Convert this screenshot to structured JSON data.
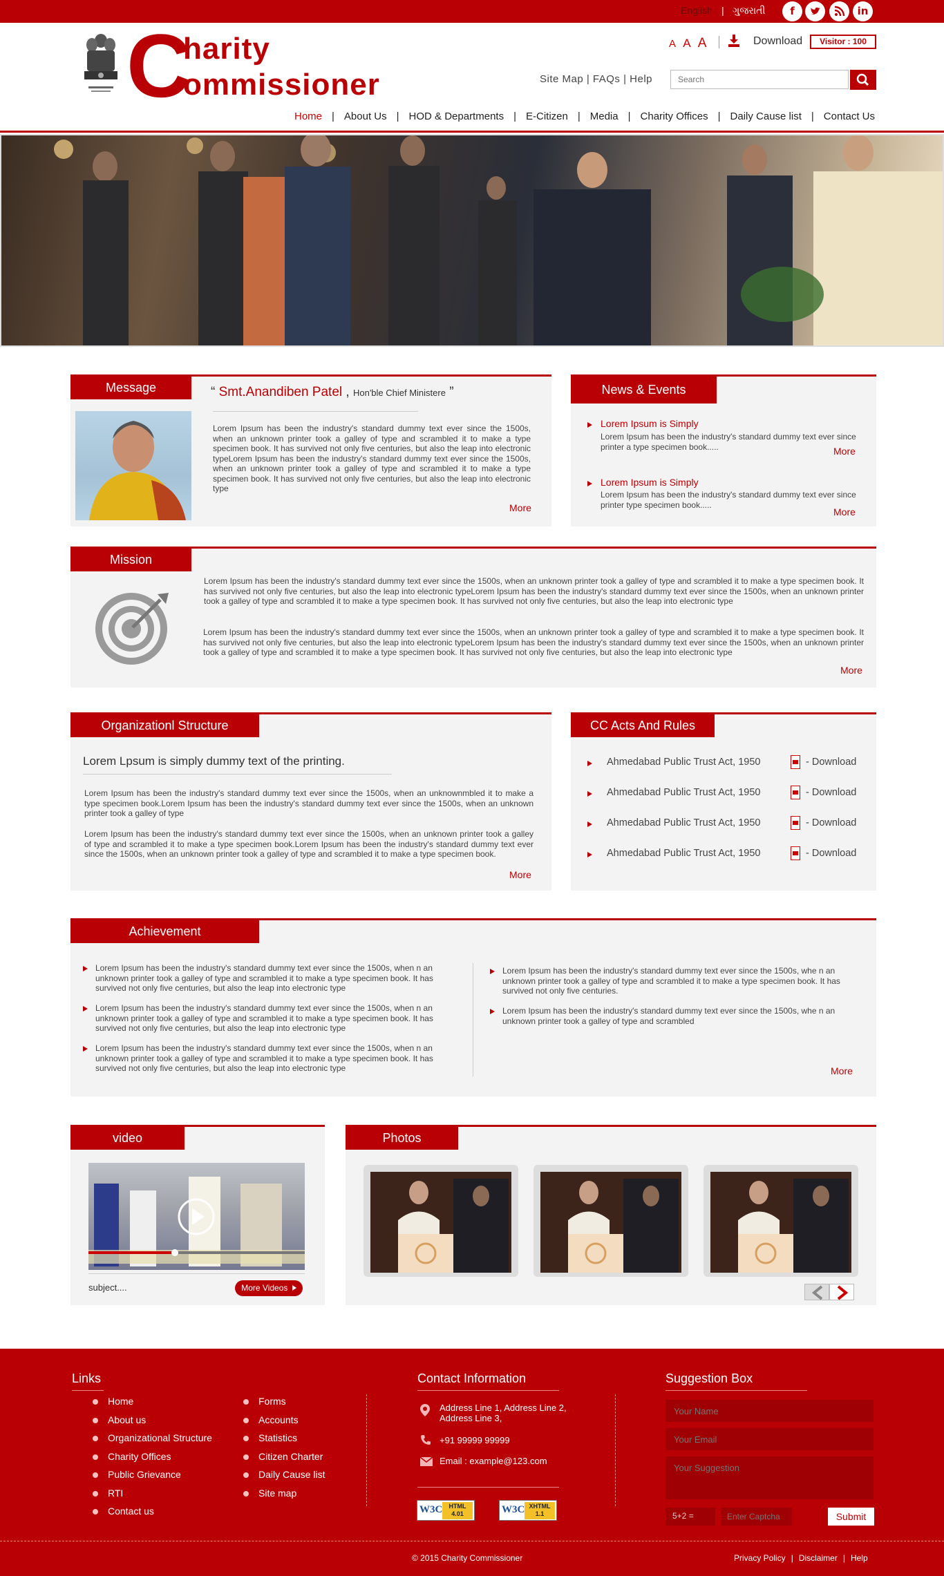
{
  "topbar": {
    "lang_en": "English",
    "lang_sep": "|",
    "lang_gu": "ગુજરાતી",
    "social": [
      "facebook-icon",
      "twitter-icon",
      "rss-icon",
      "linkedin-icon"
    ]
  },
  "header": {
    "logo_big_letter": "C",
    "logo_line1": "harity",
    "logo_line2": "ommissioner",
    "font_sizes": [
      "A",
      "A",
      "A"
    ],
    "download_label": "Download",
    "visitor_label": "Visitor :  100",
    "top_links": "Site Map | FAQs | Help",
    "search_placeholder": "Search"
  },
  "nav": {
    "items": [
      "Home",
      "About Us",
      "HOD & Departments",
      "E-Citizen",
      "Media",
      "Charity Offices",
      "Daily Cause list",
      "Contact Us"
    ],
    "active": "Home",
    "separator": "|"
  },
  "message": {
    "tab": "Message",
    "quote_open": "“",
    "name": "Smt.Anandiben Patel",
    "comma": ",",
    "role": "Hon'ble Chief Ministere",
    "quote_close": "”",
    "body": "Lorem Ipsum has been the industry's standard dummy text ever since the 1500s, when an unknown printer took a galley of type and scrambled it to make a type specimen book. It has survived not only five centuries, but also the leap into electronic typeLorem Ipsum has been the industry's standard dummy text ever since the 1500s, when an unknown printer took a galley of type and scrambled it to make a type specimen book. It has survived not only five centuries, but also the leap into electronic type",
    "more": "More"
  },
  "news": {
    "tab": "News & Events",
    "items": [
      {
        "title": "Lorem Ipsum is Simply",
        "text": "Lorem Ipsum has been the industry's standard dummy text ever since printer a type specimen book.....",
        "more": "More"
      },
      {
        "title": "Lorem Ipsum is Simply",
        "text": "Lorem Ipsum has been the industry's standard dummy text ever since printer type specimen book.....",
        "more": "More"
      }
    ]
  },
  "mission": {
    "tab": "Mission",
    "para1": "Lorem Ipsum has been the industry's standard dummy text ever since the 1500s, when an unknown printer took a galley of type and scrambled it to make a type specimen book. It has survived not only five centuries, but also the leap into electronic typeLorem Ipsum has been the industry's standard dummy text ever since the 1500s, when an unknown printer took a galley of type and scrambled it to make a type specimen book. It has survived not only five centuries, but also the leap into electronic type",
    "para2": "Lorem Ipsum has been the industry's standard dummy text ever since the 1500s, when an unknown printer took a galley of type and scrambled it to make a type specimen book. It has survived not only five centuries, but also the leap into electronic typeLorem Ipsum has been the industry's standard dummy text ever since the 1500s, when an unknown printer took a galley of type and scrambled it to make a type specimen book. It has survived not only five centuries, but also the leap into electronic type",
    "more": "More"
  },
  "org": {
    "tab": "Organizationl Structure",
    "subtitle": "Lorem Lpsum is simply dummy text of the printing.",
    "para1": "Lorem Ipsum has been the industry's standard dummy text ever since the 1500s, when an unknownmbled it to make a type specimen book.Lorem Ipsum has been the industry's standard dummy text ever since the 1500s, when an unknown printer took a galley of type",
    "para2": "Lorem Ipsum has been the industry's standard dummy text ever since the 1500s, when an unknown printer took a galley of type and scrambled it to make a type specimen book.Lorem Ipsum has been the industry's standard dummy text ever since the 1500s, when an unknown printer took a galley of type and scrambled it to make a type specimen book.",
    "more": "More"
  },
  "acts": {
    "tab": "CC Acts And Rules",
    "items": [
      {
        "name": "Ahmedabad Public Trust Act, 1950",
        "link": "- Download"
      },
      {
        "name": "Ahmedabad Public Trust Act, 1950",
        "link": "- Download"
      },
      {
        "name": "Ahmedabad Public Trust Act, 1950",
        "link": "- Download"
      },
      {
        "name": "Ahmedabad Public Trust Act, 1950",
        "link": "- Download"
      }
    ]
  },
  "achievement": {
    "tab": "Achievement",
    "left": [
      "Lorem Ipsum has been the industry's standard dummy text ever since the 1500s, when n an unknown printer took a galley of type and scrambled it to make a type specimen book. It has survived not only five centuries, but also the leap into electronic type",
      "Lorem Ipsum has been the industry's standard dummy text ever since the 1500s, when n an unknown printer took a galley of type and scrambled it to make a type specimen book. It has survived not only five centuries, but also the leap into electronic type",
      "Lorem Ipsum has been the industry's standard dummy text ever since the 1500s, when n an unknown printer took a galley of type and scrambled it to make a type specimen book. It has survived not only five centuries, but also the leap into electronic type"
    ],
    "right": [
      "Lorem Ipsum has been the industry's standard dummy text ever since the 1500s, whe n an unknown printer took a galley of type and scrambled it to make a type specimen book. It has survived not only five centuries.",
      "Lorem Ipsum has been the industry's standard dummy text ever since the 1500s, whe n an unknown printer took a galley of type and scrambled"
    ],
    "more": "More"
  },
  "video": {
    "tab": "video",
    "subject": "subject....",
    "more_button": "More Videos",
    "progress": 0.4
  },
  "photos": {
    "tab": "Photos",
    "count": 3
  },
  "footer": {
    "links_title": "Links",
    "links_col1": [
      "Home",
      "About us",
      "Organizational Structure",
      "Charity Offices",
      "Public Grievance",
      "RTI",
      "Contact us"
    ],
    "links_col2": [
      "Forms",
      "Accounts",
      "Statistics",
      "Citizen Charter",
      "Daily Cause list",
      "Site map"
    ],
    "contact_title": "Contact Information",
    "address": [
      "Address Line 1, Address Line 2,",
      "Address Line 3,"
    ],
    "phone": "+91 99999 99999",
    "email": "Email : example@123.com",
    "badges": [
      {
        "main": "W3C",
        "sub1": "HTML",
        "sub2": "4.01"
      },
      {
        "main": "W3C",
        "sub1": "XHTML",
        "sub2": "1.1"
      }
    ],
    "suggestion_title": "Suggestion Box",
    "name_placeholder": "Your Name",
    "email_placeholder": "Your Email",
    "suggestion_placeholder": "Your Suggestion",
    "captcha_question": "5+2 =",
    "captcha_placeholder": "Enter Captcha",
    "submit": "Submit",
    "copyright": "© 2015 Charity Commissioner",
    "bottom_links": [
      "Privacy Policy",
      "Disclaimer",
      "Help"
    ],
    "bottom_sep": "|"
  },
  "colors": {
    "brand_red": "#b80005",
    "panel_bg": "#f3f3f3"
  }
}
